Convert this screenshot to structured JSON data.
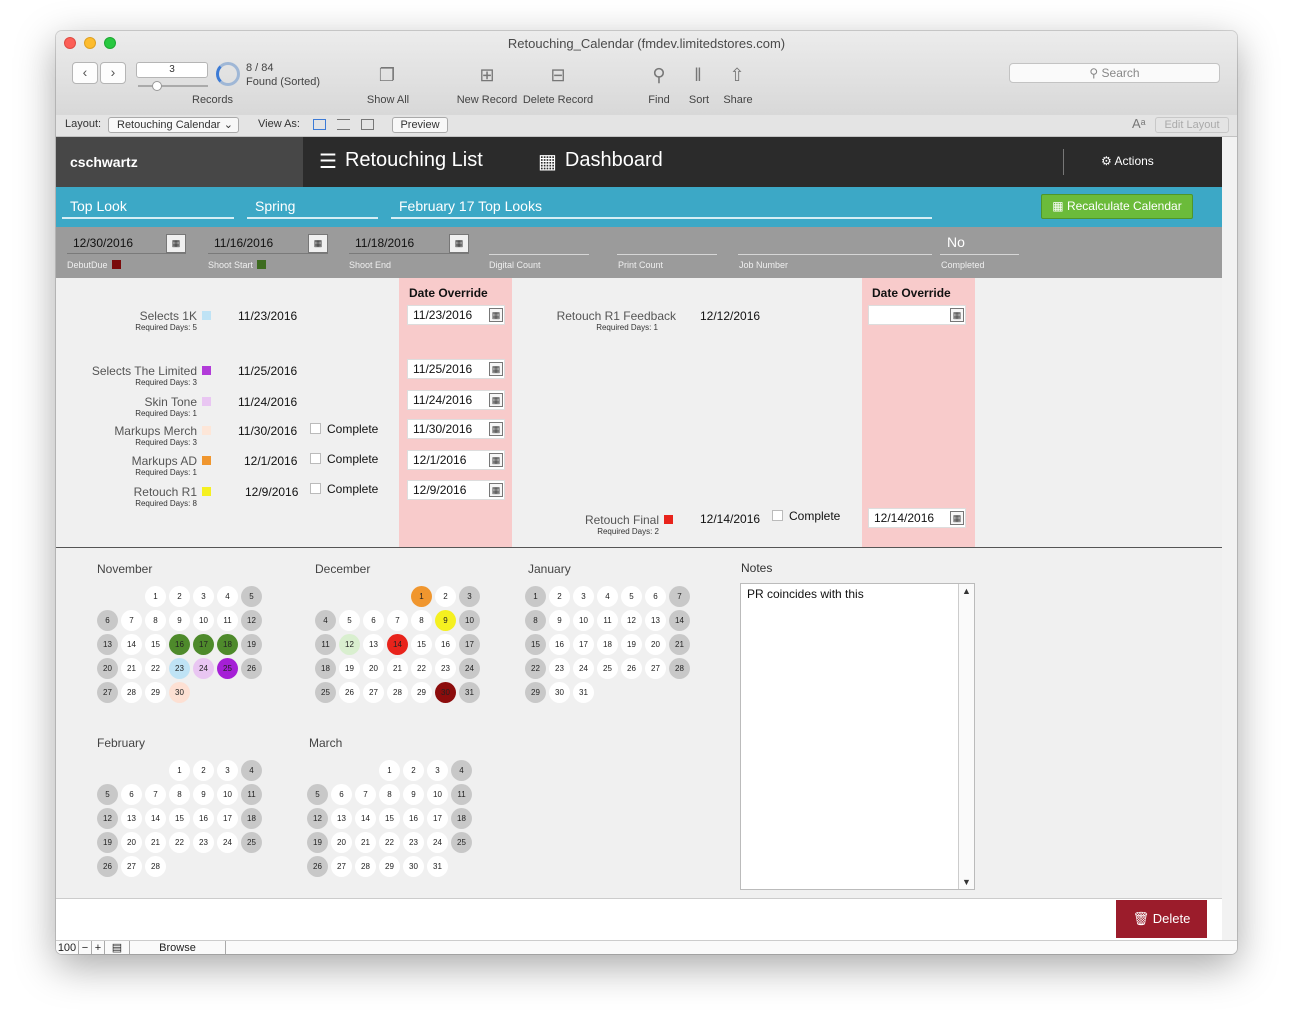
{
  "window": {
    "title": "Retouching_Calendar (fmdev.limitedstores.com)"
  },
  "toolbar": {
    "record_number": "3",
    "records_label": "Records",
    "found_count": "8 / 84",
    "found_status": "Found (Sorted)",
    "show_all": "Show All",
    "new_record": "New Record",
    "delete_record": "Delete Record",
    "find": "Find",
    "sort": "Sort",
    "share": "Share",
    "search_placeholder": "Search"
  },
  "layoutbar": {
    "layout_label": "Layout:",
    "layout_value": "Retouching Calendar",
    "view_as": "View As:",
    "preview": "Preview",
    "edit_layout": "Edit Layout"
  },
  "nav": {
    "user": "cschwartz",
    "retouching_list": "Retouching List",
    "dashboard": "Dashboard",
    "actions": "Actions"
  },
  "band": {
    "category": "Top Look",
    "season": "Spring",
    "title": "February 17 Top Looks",
    "recalculate": "Recalculate Calendar"
  },
  "fields": {
    "debut_due": {
      "value": "12/30/2016",
      "caption": "DebutDue",
      "color": "#7a0a0a"
    },
    "shoot_start": {
      "value": "11/16/2016",
      "caption": "Shoot Start",
      "color": "#3d6b1f"
    },
    "shoot_end": {
      "value": "11/18/2016",
      "caption": "Shoot End"
    },
    "digital_count": {
      "caption": "Digital Count"
    },
    "print_count": {
      "caption": "Print Count"
    },
    "job_number": {
      "caption": "Job Number"
    },
    "completed": {
      "value": "No",
      "caption": "Completed"
    }
  },
  "schedule": {
    "override_header": "Date Override",
    "required_prefix": "Required Days:",
    "complete_label": "Complete",
    "left": [
      {
        "name": "Selects 1K",
        "required": "Required Days: 5",
        "date": "11/23/2016",
        "override": "11/23/2016",
        "color": "#bfe3f5",
        "complete": false
      },
      {
        "name": "Selects The Limited",
        "required": "Required Days: 3",
        "date": "11/25/2016",
        "override": "11/25/2016",
        "color": "#b23bd9",
        "complete": false
      },
      {
        "name": "Skin Tone",
        "required": "Required Days: 1",
        "date": "11/24/2016",
        "override": "11/24/2016",
        "color": "#e9c6f2",
        "complete": false
      },
      {
        "name": "Markups Merch",
        "required": "Required Days: 3",
        "date": "11/30/2016",
        "override": "11/30/2016",
        "color": "#fde6d8",
        "complete": true
      },
      {
        "name": "Markups AD",
        "required": "Required Days: 1",
        "date": "12/1/2016",
        "override": "12/1/2016",
        "color": "#f0962e",
        "complete": true
      },
      {
        "name": "Retouch R1",
        "required": "Required Days: 8",
        "date": "12/9/2016",
        "override": "12/9/2016",
        "color": "#f5f020",
        "complete": true
      }
    ],
    "right": [
      {
        "name": "Retouch R1 Feedback",
        "required": "Required Days: 1",
        "date": "12/12/2016",
        "override": ""
      },
      {
        "name": "Retouch Final",
        "required": "Required Days: 2",
        "date": "12/14/2016",
        "override": "12/14/2016",
        "color": "#e8231b"
      }
    ]
  },
  "calendar": {
    "months": [
      {
        "name": "November",
        "offset": 2,
        "days": 30,
        "highlights": {
          "16": "#4e8a2b",
          "17": "#4e8a2b",
          "18": "#4e8a2b",
          "23": "#bfe3f5",
          "24": "#e9c6f2",
          "25": "#a51fd6",
          "30": "#fde0d3"
        }
      },
      {
        "name": "December",
        "offset": 4,
        "days": 31,
        "highlights": {
          "1": "#f0962e",
          "9": "#f5f020",
          "12": "#d9efcf",
          "14": "#e8231b",
          "30": "#8c0c0c"
        }
      },
      {
        "name": "January",
        "offset": 0,
        "days": 31,
        "highlights": {}
      },
      {
        "name": "February",
        "offset": 3,
        "days": 28,
        "highlights": {}
      },
      {
        "name": "March",
        "offset": 3,
        "days": 31,
        "highlights": {}
      }
    ]
  },
  "notes": {
    "label": "Notes",
    "text": "PR coincides with this"
  },
  "footer": {
    "delete": "Delete"
  },
  "statusbar": {
    "zoom": "100",
    "mode": "Browse"
  }
}
